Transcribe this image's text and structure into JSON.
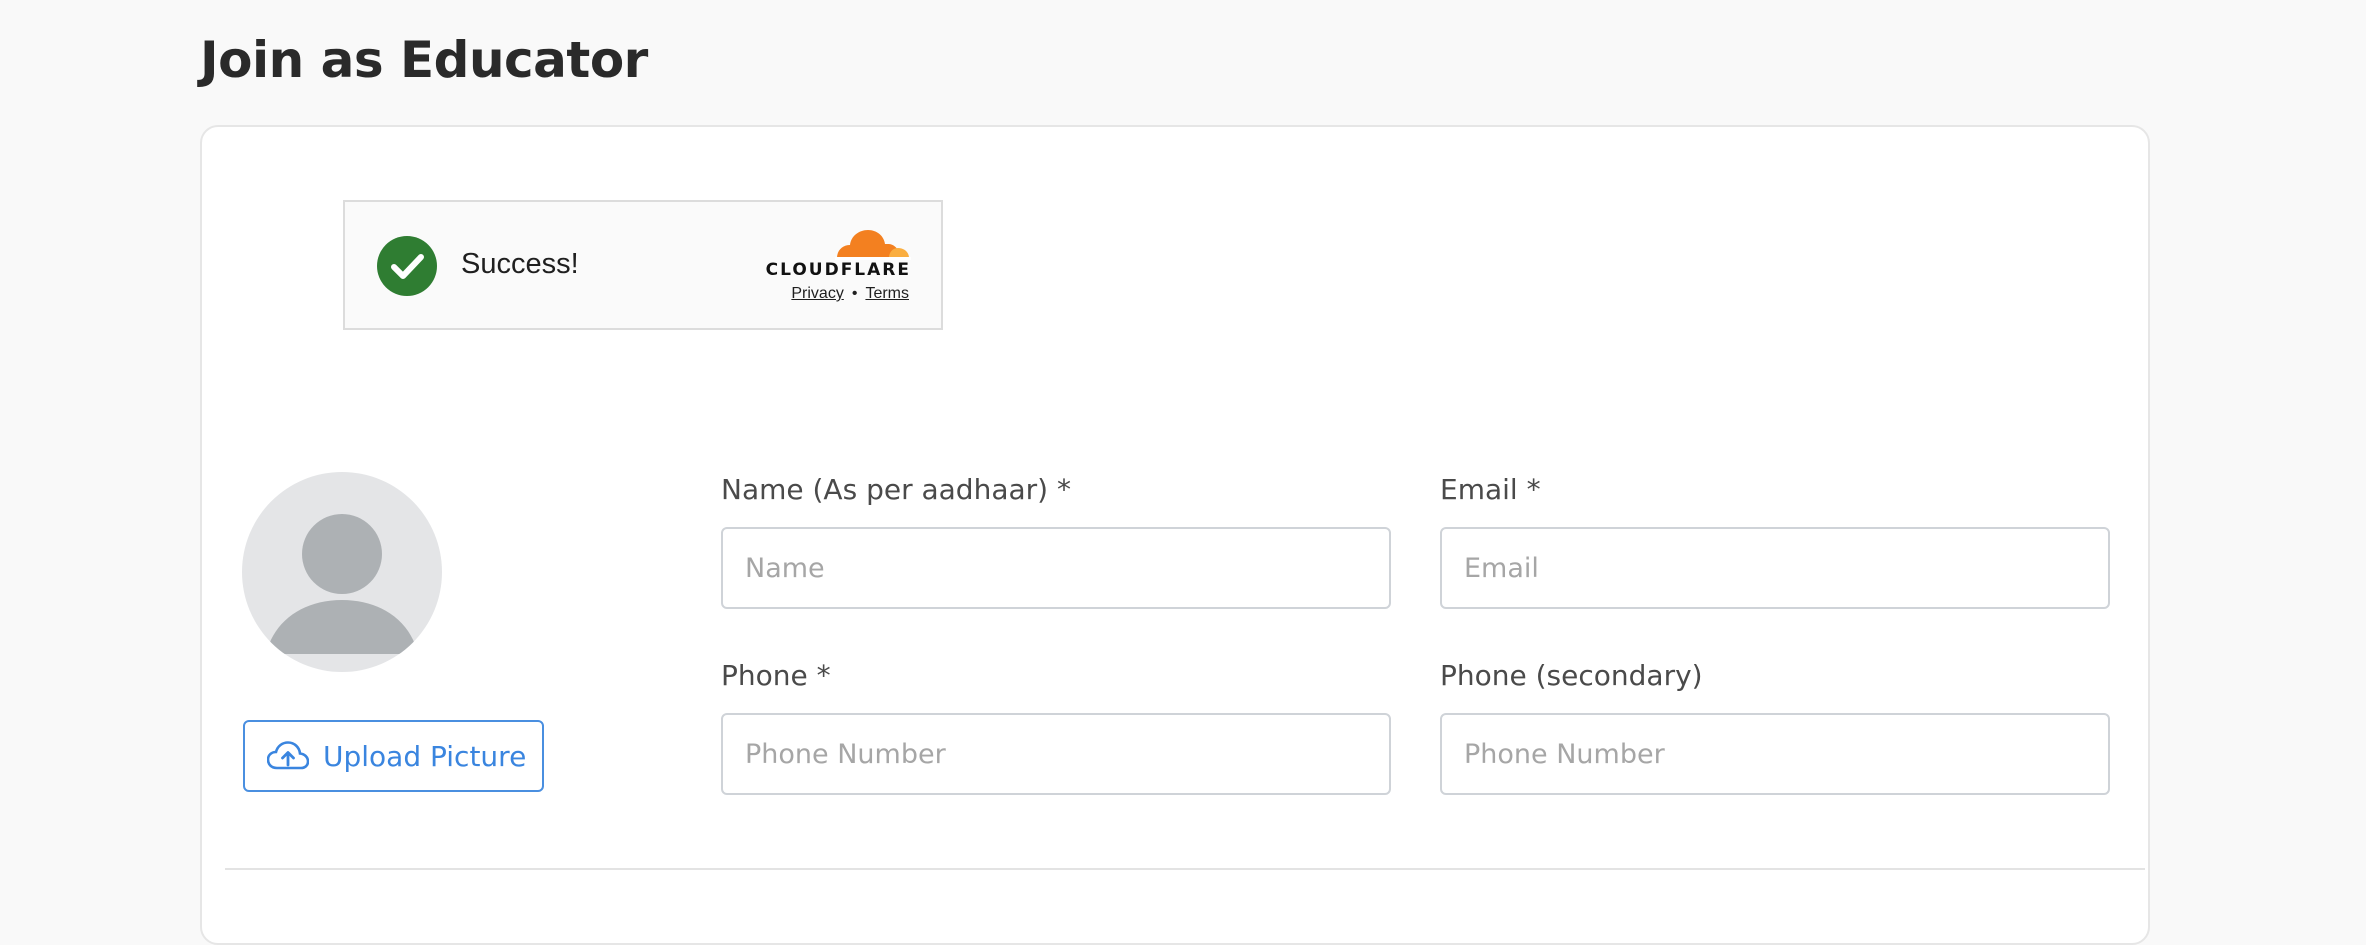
{
  "page": {
    "title": "Join as Educator"
  },
  "captcha": {
    "status": "Success!",
    "provider": "CLOUDFLARE",
    "privacy_label": "Privacy",
    "separator": "•",
    "terms_label": "Terms",
    "check_icon": "checkmark-circle-icon",
    "check_color": "#2f7d32",
    "brand_colors": [
      "#f38020",
      "#faae40"
    ]
  },
  "profile": {
    "avatar_icon": "user-placeholder-icon",
    "upload_label": "Upload Picture",
    "upload_icon": "cloud-upload-icon",
    "accent": "#3a85df"
  },
  "form": {
    "name": {
      "label": "Name (As per aadhaar) *",
      "placeholder": "Name",
      "value": ""
    },
    "email": {
      "label": "Email *",
      "placeholder": "Email",
      "value": ""
    },
    "phone": {
      "label": "Phone *",
      "placeholder": "Phone Number",
      "value": ""
    },
    "phone_secondary": {
      "label": "Phone (secondary)",
      "placeholder": "Phone Number",
      "value": ""
    }
  }
}
